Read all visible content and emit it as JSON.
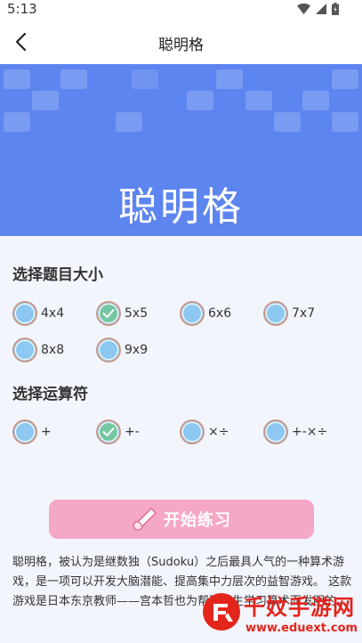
{
  "status_bar": {
    "time": "5:13",
    "icons": [
      "wifi-icon",
      "signal-icon",
      "battery-icon"
    ]
  },
  "header": {
    "back_icon": "chevron-left-icon",
    "title": "聪明格"
  },
  "banner": {
    "title": "聪明格",
    "color": "#5d85f0"
  },
  "size_section": {
    "title": "选择题目大小",
    "options": [
      {
        "label": "4x4",
        "checked": false
      },
      {
        "label": "5x5",
        "checked": true
      },
      {
        "label": "6x6",
        "checked": false
      },
      {
        "label": "7x7",
        "checked": false
      },
      {
        "label": "8x8",
        "checked": false
      },
      {
        "label": "9x9",
        "checked": false
      }
    ]
  },
  "operator_section": {
    "title": "选择运算符",
    "options": [
      {
        "label": "+",
        "checked": false
      },
      {
        "label": "+-",
        "checked": true
      },
      {
        "label": "×÷",
        "checked": false
      },
      {
        "label": "+-×÷",
        "checked": false
      }
    ]
  },
  "start_button": {
    "label": "开始练习",
    "icon": "pencil-hand-icon",
    "color": "#f5a7c6"
  },
  "description": "聪明格，被认为是继数独（Sudoku）之后最具人气的一种算术游戏，是一项可以开发大脑潜能、提高集中力层次的益智游戏。 这款游戏是日本东京教师——宫本哲也为帮助学生学习算术而发明的。",
  "watermark": {
    "name": "千妏手游网",
    "url": "www.eduext.com",
    "color": "#e3251b"
  }
}
